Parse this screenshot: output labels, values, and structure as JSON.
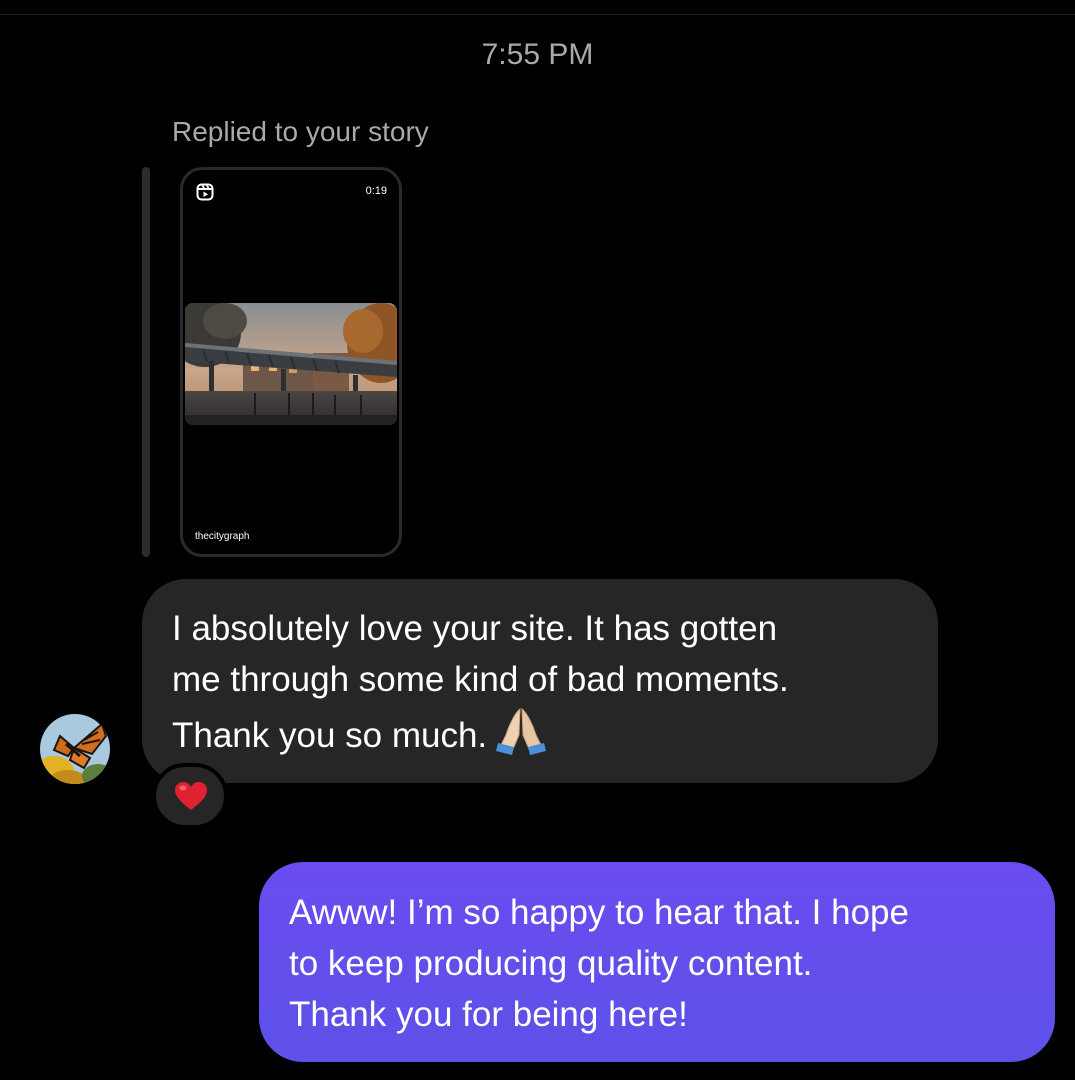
{
  "conversation": {
    "timestamp": "7:55 PM"
  },
  "story_reply": {
    "label": "Replied to your story",
    "duration": "0:19",
    "username": "thecitygraph",
    "reel_icon": "reels-icon"
  },
  "incoming": {
    "avatar": "butterfly-avatar",
    "lines": [
      "I absolutely love your site. It has gotten",
      "me through some kind of bad moments.",
      "Thank you so much."
    ],
    "emoji": "folded-hands-emoji",
    "reaction": "red-heart"
  },
  "outgoing": {
    "lines": [
      "Awww! I’m so happy to hear that. I hope",
      "to keep producing quality content.",
      "Thank you for being here!"
    ]
  },
  "colors": {
    "background": "#000000",
    "incoming_bubble": "#262626",
    "outgoing_bubble": "#6450ee",
    "secondary_text": "#a9a9ad",
    "heart": "#e0212f"
  }
}
